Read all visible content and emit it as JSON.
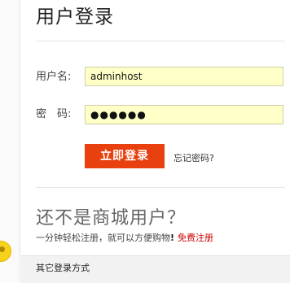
{
  "title": "用户登录",
  "form": {
    "username_label": "用户名:",
    "username_value": "adminhost",
    "password_label": "密　码:",
    "password_value": "●●●●●●",
    "login_button": "立即登录",
    "forgot_link": "忘记密码?"
  },
  "register": {
    "heading": "还不是商城用户？",
    "text": "一分钟轻松注册，就可以方便购物",
    "exclaim": "!",
    "link": "免费注册"
  },
  "other_login": {
    "label": "其它登录方式"
  }
}
